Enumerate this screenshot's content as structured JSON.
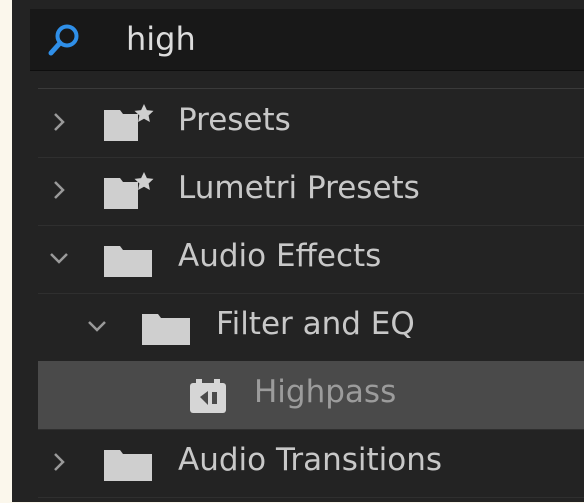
{
  "search": {
    "value": "high",
    "icon": "magnifier-icon",
    "accent_color": "#2f8fe8"
  },
  "tree": [
    {
      "label": "Presets",
      "icon": "folder-star-icon",
      "expanded": false
    },
    {
      "label": "Lumetri Presets",
      "icon": "folder-star-icon",
      "expanded": false
    },
    {
      "label": "Audio Effects",
      "icon": "folder-icon",
      "expanded": true
    },
    {
      "label": "Filter and EQ",
      "icon": "folder-icon",
      "expanded": true
    },
    {
      "label": "Highpass",
      "icon": "audio-effect-icon",
      "selected": true
    },
    {
      "label": "Audio Transitions",
      "icon": "folder-icon",
      "expanded": false
    }
  ]
}
